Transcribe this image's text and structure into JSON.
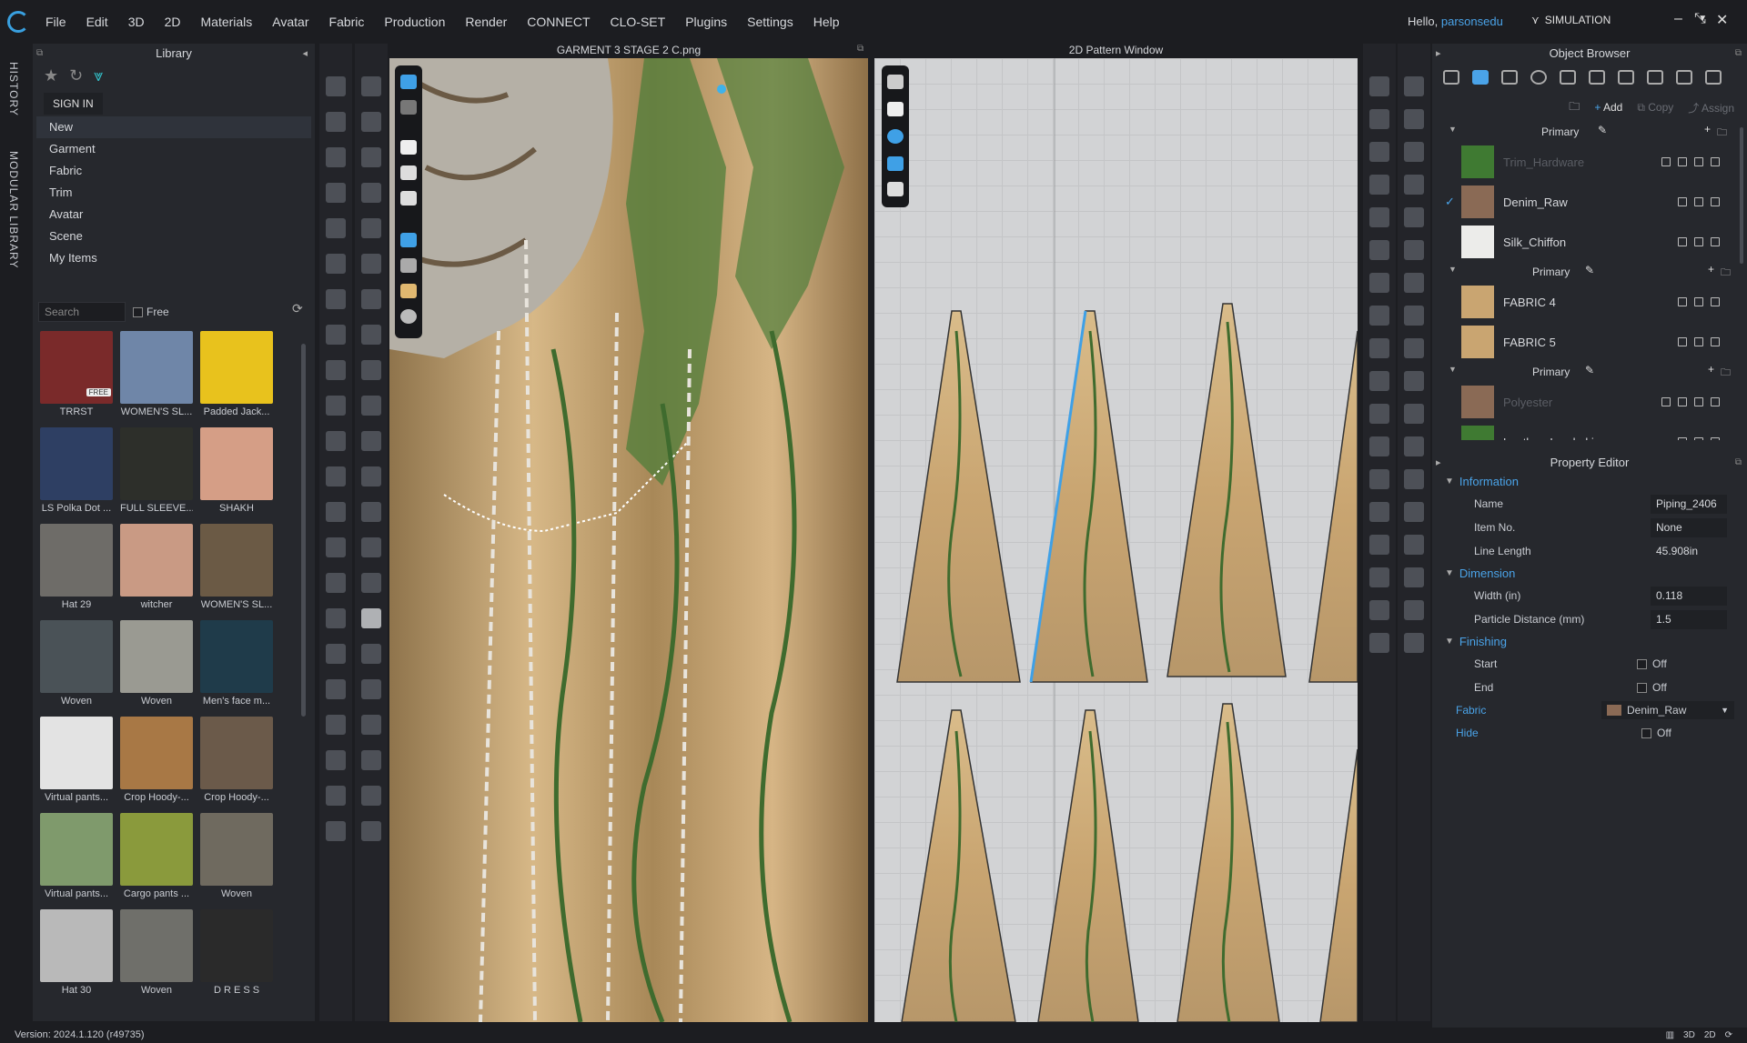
{
  "menubar": {
    "items": [
      "File",
      "Edit",
      "3D",
      "2D",
      "Materials",
      "Avatar",
      "Fabric",
      "Production",
      "Render",
      "CONNECT",
      "CLO-SET",
      "Plugins",
      "Settings",
      "Help"
    ],
    "greeting": "Hello,",
    "username": "parsonsedu",
    "mode": "SIMULATION"
  },
  "sidebar_tabs": {
    "history": "HISTORY",
    "modular": "MODULAR LIBRARY"
  },
  "library": {
    "title": "Library",
    "signin": "SIGN IN",
    "nav": [
      "New",
      "Garment",
      "Fabric",
      "Trim",
      "Avatar",
      "Scene",
      "My Items"
    ],
    "search_placeholder": "Search",
    "free_label": "Free",
    "items": [
      {
        "label": "TRRST",
        "color": "#7a2a2a",
        "badge": "FREE"
      },
      {
        "label": "WOMEN'S SL...",
        "color": "#6f86a8"
      },
      {
        "label": "Padded Jack...",
        "color": "#e8c21d"
      },
      {
        "label": "LS Polka Dot ...",
        "color": "#2e3f63"
      },
      {
        "label": "FULL SLEEVE...",
        "color": "#2d2f2a"
      },
      {
        "label": "SHAKH",
        "color": "#d59e86"
      },
      {
        "label": "Hat 29",
        "color": "#6e6c68"
      },
      {
        "label": "witcher",
        "color": "#c99a84"
      },
      {
        "label": "WOMEN'S SL...",
        "color": "#6b5a45"
      },
      {
        "label": "Woven",
        "color": "#4a5257"
      },
      {
        "label": "Woven",
        "color": "#9a9a92"
      },
      {
        "label": "Men's face m...",
        "color": "#1f3b4a"
      },
      {
        "label": "Virtual pants...",
        "color": "#e3e3e3"
      },
      {
        "label": "Crop Hoody-...",
        "color": "#a87845"
      },
      {
        "label": "Crop Hoody-...",
        "color": "#6b5a4a"
      },
      {
        "label": "Virtual pants...",
        "color": "#7f9a6c"
      },
      {
        "label": "Cargo pants ...",
        "color": "#8a9a3c"
      },
      {
        "label": "Woven",
        "color": "#6f6a5f"
      },
      {
        "label": "Hat 30",
        "color": "#b9b9b9"
      },
      {
        "label": "Woven",
        "color": "#6f6f6a"
      },
      {
        "label": "D R E S S",
        "color": "#2a2a2a"
      }
    ]
  },
  "viewport3d": {
    "title": "GARMENT 3 STAGE 2 C.png"
  },
  "pattern_window": {
    "title": "2D Pattern Window"
  },
  "object_browser": {
    "title": "Object Browser",
    "add_label": "Add",
    "copy_label": "Copy",
    "assign_label": "Assign",
    "groups": [
      {
        "name": "Primary",
        "fabrics": [
          {
            "name": "Trim_Hardware",
            "color": "#3f7a32",
            "dim": true
          },
          {
            "name": "Denim_Raw",
            "color": "#8a6a55",
            "checked": true
          },
          {
            "name": "Silk_Chiffon",
            "color": "#ececea"
          }
        ]
      },
      {
        "name": "Primary",
        "fabrics": [
          {
            "name": "FABRIC 4",
            "color": "#c9a571"
          },
          {
            "name": "FABRIC 5",
            "color": "#c9a571"
          }
        ]
      },
      {
        "name": "Primary",
        "fabrics": [
          {
            "name": "Polyester",
            "color": "#8a6a55",
            "dim": true
          },
          {
            "name": "Leather_Lambskin",
            "color": "#3f7a32"
          }
        ]
      }
    ]
  },
  "property_editor": {
    "title": "Property Editor",
    "information": {
      "section": "Information",
      "name_label": "Name",
      "name_value": "Piping_2406",
      "itemno_label": "Item No.",
      "itemno_value": "None",
      "length_label": "Line Length",
      "length_value": "45.908in"
    },
    "dimension": {
      "section": "Dimension",
      "width_label": "Width (in)",
      "width_value": "0.118",
      "particle_label": "Particle Distance (mm)",
      "particle_value": "1.5"
    },
    "finishing": {
      "section": "Finishing",
      "start_label": "Start",
      "start_value": "Off",
      "end_label": "End",
      "end_value": "Off"
    },
    "fabric": {
      "label": "Fabric",
      "value": "Denim_Raw"
    },
    "hide": {
      "label": "Hide",
      "value": "Off"
    }
  },
  "status": {
    "version": "Version: 2024.1.120 (r49735)"
  },
  "colors": {
    "accent": "#4aa3e8",
    "panel": "#26282d",
    "background": "#1c1d21"
  }
}
